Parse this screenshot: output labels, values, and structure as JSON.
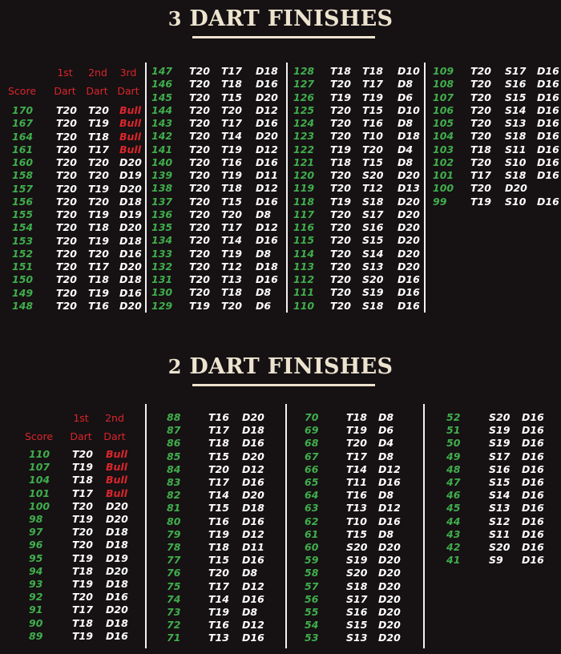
{
  "three_dart": {
    "title_num": "3",
    "title_text": "DART FINISHES",
    "headers": {
      "score": "Score",
      "first_top": "1st",
      "second_top": "2nd",
      "third_top": "3rd",
      "dart": "Dart"
    },
    "columns": [
      [
        [
          "170",
          "T20",
          "T20",
          "Bull"
        ],
        [
          "167",
          "T20",
          "T19",
          "Bull"
        ],
        [
          "164",
          "T20",
          "T18",
          "Bull"
        ],
        [
          "161",
          "T20",
          "T17",
          "Bull"
        ],
        [
          "160",
          "T20",
          "T20",
          "D20"
        ],
        [
          "158",
          "T20",
          "T20",
          "D19"
        ],
        [
          "157",
          "T20",
          "T19",
          "D20"
        ],
        [
          "156",
          "T20",
          "T20",
          "D18"
        ],
        [
          "155",
          "T20",
          "T19",
          "D19"
        ],
        [
          "154",
          "T20",
          "T18",
          "D20"
        ],
        [
          "153",
          "T20",
          "T19",
          "D18"
        ],
        [
          "152",
          "T20",
          "T20",
          "D16"
        ],
        [
          "151",
          "T20",
          "T17",
          "D20"
        ],
        [
          "150",
          "T20",
          "T18",
          "D18"
        ],
        [
          "149",
          "T20",
          "T19",
          "D16"
        ],
        [
          "148",
          "T20",
          "T16",
          "D20"
        ]
      ],
      [
        [
          "147",
          "T20",
          "T17",
          "D18"
        ],
        [
          "146",
          "T20",
          "T18",
          "D16"
        ],
        [
          "145",
          "T20",
          "T15",
          "D20"
        ],
        [
          "144",
          "T20",
          "T20",
          "D12"
        ],
        [
          "143",
          "T20",
          "T17",
          "D16"
        ],
        [
          "142",
          "T20",
          "T14",
          "D20"
        ],
        [
          "141",
          "T20",
          "T19",
          "D12"
        ],
        [
          "140",
          "T20",
          "T16",
          "D16"
        ],
        [
          "139",
          "T20",
          "T19",
          "D11"
        ],
        [
          "138",
          "T20",
          "T18",
          "D12"
        ],
        [
          "137",
          "T20",
          "T15",
          "D16"
        ],
        [
          "136",
          "T20",
          "T20",
          "D8"
        ],
        [
          "135",
          "T20",
          "T17",
          "D12"
        ],
        [
          "134",
          "T20",
          "T14",
          "D16"
        ],
        [
          "133",
          "T20",
          "T19",
          "D8"
        ],
        [
          "132",
          "T20",
          "T12",
          "D18"
        ],
        [
          "131",
          "T20",
          "T13",
          "D16"
        ],
        [
          "130",
          "T20",
          "T18",
          "D8"
        ],
        [
          "129",
          "T19",
          "T20",
          "D6"
        ]
      ],
      [
        [
          "128",
          "T18",
          "T18",
          "D10"
        ],
        [
          "127",
          "T20",
          "T17",
          "D8"
        ],
        [
          "126",
          "T19",
          "T19",
          "D6"
        ],
        [
          "125",
          "T20",
          "T15",
          "D10"
        ],
        [
          "124",
          "T20",
          "T16",
          "D8"
        ],
        [
          "123",
          "T20",
          "T10",
          "D18"
        ],
        [
          "122",
          "T19",
          "T20",
          "D4"
        ],
        [
          "121",
          "T18",
          "T15",
          "D8"
        ],
        [
          "120",
          "T20",
          "S20",
          "D20"
        ],
        [
          "119",
          "T20",
          "T12",
          "D13"
        ],
        [
          "118",
          "T19",
          "S18",
          "D20"
        ],
        [
          "117",
          "T20",
          "S17",
          "D20"
        ],
        [
          "116",
          "T20",
          "S16",
          "D20"
        ],
        [
          "115",
          "T20",
          "S15",
          "D20"
        ],
        [
          "114",
          "T20",
          "S14",
          "D20"
        ],
        [
          "113",
          "T20",
          "S13",
          "D20"
        ],
        [
          "112",
          "T20",
          "S20",
          "D16"
        ],
        [
          "111",
          "T20",
          "S19",
          "D16"
        ],
        [
          "110",
          "T20",
          "S18",
          "D16"
        ]
      ],
      [
        [
          "109",
          "T20",
          "S17",
          "D16"
        ],
        [
          "108",
          "T20",
          "S16",
          "D16"
        ],
        [
          "107",
          "T20",
          "S15",
          "D16"
        ],
        [
          "106",
          "T20",
          "S14",
          "D16"
        ],
        [
          "105",
          "T20",
          "S13",
          "D16"
        ],
        [
          "104",
          "T20",
          "S18",
          "D16"
        ],
        [
          "103",
          "T18",
          "S11",
          "D16"
        ],
        [
          "102",
          "T20",
          "S10",
          "D16"
        ],
        [
          "101",
          "T17",
          "S18",
          "D16"
        ],
        [
          "100",
          "T20",
          "D20",
          ""
        ],
        [
          "99",
          "T19",
          "S10",
          "D16"
        ]
      ]
    ]
  },
  "two_dart": {
    "title_num": "2",
    "title_text": "DART FINISHES",
    "headers": {
      "score": "Score",
      "first_top": "1st",
      "second_top": "2nd",
      "dart": "Dart"
    },
    "columns": [
      [
        [
          "110",
          "T20",
          "Bull"
        ],
        [
          "107",
          "T19",
          "Bull"
        ],
        [
          "104",
          "T18",
          "Bull"
        ],
        [
          "101",
          "T17",
          "Bull"
        ],
        [
          "100",
          "T20",
          "D20"
        ],
        [
          "98",
          "T19",
          "D20"
        ],
        [
          "97",
          "T20",
          "D18"
        ],
        [
          "96",
          "T20",
          "D18"
        ],
        [
          "95",
          "T19",
          "D19"
        ],
        [
          "94",
          "T18",
          "D20"
        ],
        [
          "93",
          "T19",
          "D18"
        ],
        [
          "92",
          "T20",
          "D16"
        ],
        [
          "91",
          "T17",
          "D20"
        ],
        [
          "90",
          "T18",
          "D18"
        ],
        [
          "89",
          "T19",
          "D16"
        ]
      ],
      [
        [
          "88",
          "T16",
          "D20"
        ],
        [
          "87",
          "T17",
          "D18"
        ],
        [
          "86",
          "T18",
          "D16"
        ],
        [
          "85",
          "T15",
          "D20"
        ],
        [
          "84",
          "T20",
          "D12"
        ],
        [
          "83",
          "T17",
          "D16"
        ],
        [
          "82",
          "T14",
          "D20"
        ],
        [
          "81",
          "T15",
          "D18"
        ],
        [
          "80",
          "T16",
          "D16"
        ],
        [
          "79",
          "T19",
          "D12"
        ],
        [
          "78",
          "T18",
          "D11"
        ],
        [
          "77",
          "T15",
          "D16"
        ],
        [
          "76",
          "T20",
          "D8"
        ],
        [
          "75",
          "T17",
          "D12"
        ],
        [
          "74",
          "T14",
          "D16"
        ],
        [
          "73",
          "T19",
          "D8"
        ],
        [
          "72",
          "T16",
          "D12"
        ],
        [
          "71",
          "T13",
          "D16"
        ]
      ],
      [
        [
          "70",
          "T18",
          "D8"
        ],
        [
          "69",
          "T19",
          "D6"
        ],
        [
          "68",
          "T20",
          "D4"
        ],
        [
          "67",
          "T17",
          "D8"
        ],
        [
          "66",
          "T14",
          "D12"
        ],
        [
          "65",
          "T11",
          "D16"
        ],
        [
          "64",
          "T16",
          "D8"
        ],
        [
          "63",
          "T13",
          "D12"
        ],
        [
          "62",
          "T10",
          "D16"
        ],
        [
          "61",
          "T15",
          "D8"
        ],
        [
          "60",
          "S20",
          "D20"
        ],
        [
          "59",
          "S19",
          "D20"
        ],
        [
          "58",
          "S20",
          "D20"
        ],
        [
          "57",
          "S18",
          "D20"
        ],
        [
          "56",
          "S17",
          "D20"
        ],
        [
          "55",
          "S16",
          "D20"
        ],
        [
          "54",
          "S15",
          "D20"
        ],
        [
          "53",
          "S13",
          "D20"
        ]
      ],
      [
        [
          "52",
          "S20",
          "D16"
        ],
        [
          "51",
          "S19",
          "D16"
        ],
        [
          "50",
          "S19",
          "D16"
        ],
        [
          "49",
          "S17",
          "D16"
        ],
        [
          "48",
          "S16",
          "D16"
        ],
        [
          "47",
          "S15",
          "D16"
        ],
        [
          "46",
          "S14",
          "D16"
        ],
        [
          "45",
          "S13",
          "D16"
        ],
        [
          "44",
          "S12",
          "D16"
        ],
        [
          "43",
          "S11",
          "D16"
        ],
        [
          "42",
          "S20",
          "D16"
        ],
        [
          "41",
          "S9",
          "D16"
        ]
      ]
    ]
  },
  "colors": {
    "background": "#161113",
    "title": "#ece3cf",
    "score": "#3fae4c",
    "bull": "#d9262b",
    "text": "#ffffff"
  }
}
